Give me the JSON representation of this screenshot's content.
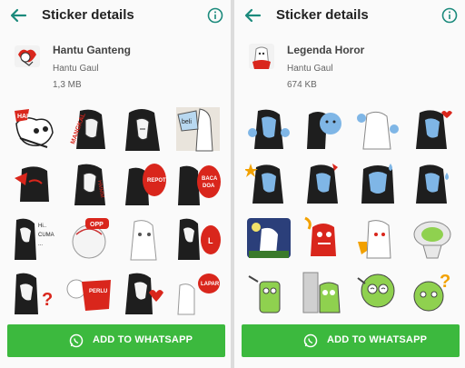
{
  "colors": {
    "accent": "#1b8a7c",
    "button": "#3cb93e",
    "background": "#fafafa"
  },
  "panels": [
    {
      "title": "Sticker details",
      "pack": {
        "name": "Hantu Ganteng",
        "author": "Hantu Gaul",
        "size": "1,3 MB"
      },
      "stickers": [
        {
          "icon": "ghost-hai-sticker",
          "text": "HAI!"
        },
        {
          "icon": "ghost-mangkal-sticker",
          "text": "MANGKAL"
        },
        {
          "icon": "long-hair-ghost-sticker",
          "text": ""
        },
        {
          "icon": "pocong-beli-sticker",
          "text": "beli"
        },
        {
          "icon": "angry-ghost-sticker",
          "text": "!"
        },
        {
          "icon": "bored-ghost-sticker",
          "text": "HMMM"
        },
        {
          "icon": "ghost-repot-sticker",
          "text": "REPOT"
        },
        {
          "icon": "ghost-baca-sticker",
          "text": "BACA DOA"
        },
        {
          "icon": "ghost-cuma-sticker",
          "text": "CUMA"
        },
        {
          "icon": "ghost-opp-sticker",
          "text": "OPP"
        },
        {
          "icon": "white-ghost-sticker",
          "text": ""
        },
        {
          "icon": "ghost-l-sticker",
          "text": "L"
        },
        {
          "icon": "ghost-question-sticker",
          "text": "?"
        },
        {
          "icon": "ghost-perlu-sticker",
          "text": "PERLU"
        },
        {
          "icon": "ghost-heart-sticker",
          "text": ""
        },
        {
          "icon": "ghost-laper-sticker",
          "text": "LAPAR"
        }
      ],
      "add_label": "ADD TO WHATSAPP"
    },
    {
      "title": "Sticker details",
      "pack": {
        "name": "Legenda Horor",
        "author": "Hantu Gaul",
        "size": "674 KB"
      },
      "stickers": [
        {
          "icon": "blue-ghost-sticker",
          "text": ""
        },
        {
          "icon": "blue-ghost-hair-sticker",
          "text": ""
        },
        {
          "icon": "pocong-hands-sticker",
          "text": ""
        },
        {
          "icon": "blue-ghost-heart-sticker",
          "text": ""
        },
        {
          "icon": "blue-ghost-star-sticker",
          "text": ""
        },
        {
          "icon": "blue-ghost-angry-sticker",
          "text": ""
        },
        {
          "icon": "blue-ghost-sweat-sticker",
          "text": ""
        },
        {
          "icon": "blue-ghost-cry-sticker",
          "text": ""
        },
        {
          "icon": "night-ghost-sticker",
          "text": ""
        },
        {
          "icon": "red-monster-sticker",
          "text": ""
        },
        {
          "icon": "thumbs-down-ghost-sticker",
          "text": ""
        },
        {
          "icon": "toilet-ghost-sticker",
          "text": ""
        },
        {
          "icon": "green-ghost-sticker",
          "text": ""
        },
        {
          "icon": "door-ghost-sticker",
          "text": ""
        },
        {
          "icon": "swirl-eye-ghost-sticker",
          "text": ""
        },
        {
          "icon": "green-question-sticker",
          "text": "?"
        }
      ],
      "add_label": "ADD TO WHATSAPP"
    }
  ]
}
